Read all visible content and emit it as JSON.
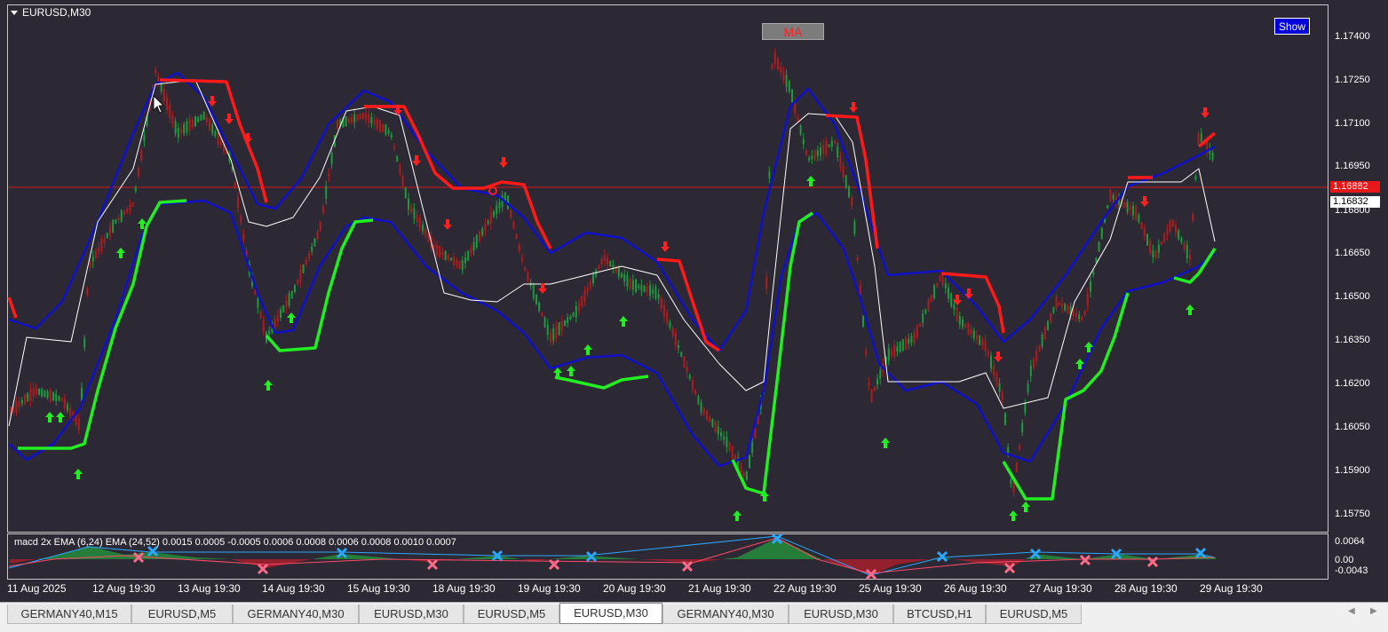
{
  "chart": {
    "symbol_label": "EURUSD,M30",
    "show_button": "Show",
    "ma_button": "MA",
    "bid_price": "1.16882",
    "ask_price": "1.16832",
    "price_axis": [
      "1.17400",
      "1.17250",
      "1.17100",
      "1.16950",
      "1.16800",
      "1.16650",
      "1.16500",
      "1.16350",
      "1.16200",
      "1.16050",
      "1.15900",
      "1.15750"
    ],
    "date_axis": [
      "11 Aug 2025",
      "12 Aug 19:30",
      "13 Aug 19:30",
      "14 Aug 19:30",
      "15 Aug 19:30",
      "18 Aug 19:30",
      "19 Aug 19:30",
      "20 Aug 19:30",
      "21 Aug 19:30",
      "22 Aug 19:30",
      "25 Aug 19:30",
      "26 Aug 19:30",
      "27 Aug 19:30",
      "28 Aug 19:30",
      "29 Aug 19:30"
    ],
    "colors": {
      "background": "#2c2934",
      "upper_band": "#1010c8",
      "mid_line": "#ffffff",
      "bear_line": "#ff1a1a",
      "bull_line": "#22ee22",
      "bull_candle": "#1e9a3c",
      "bear_candle": "#b01c1c"
    }
  },
  "macd": {
    "title": "macd 2x EMA (6,24) EMA (24,52)  0.0015 0.0005 -0.0005 0.0006 0.0008 0.0006 0.0008 0.0010 0.0007",
    "axis": [
      "0.0064",
      "0.00",
      "-0.0043"
    ]
  },
  "tabs": [
    {
      "label": "GERMANY40,M15",
      "active": false
    },
    {
      "label": "EURUSD,M5",
      "active": false
    },
    {
      "label": "GERMANY40,M30",
      "active": false
    },
    {
      "label": "EURUSD,M30",
      "active": false
    },
    {
      "label": "EURUSD,M5",
      "active": false
    },
    {
      "label": "EURUSD,M30",
      "active": true
    },
    {
      "label": "GERMANY40,M30",
      "active": false
    },
    {
      "label": "EURUSD,M30",
      "active": false
    },
    {
      "label": "BTCUSD,H1",
      "active": false
    },
    {
      "label": "EURUSD,M5",
      "active": false
    }
  ]
}
